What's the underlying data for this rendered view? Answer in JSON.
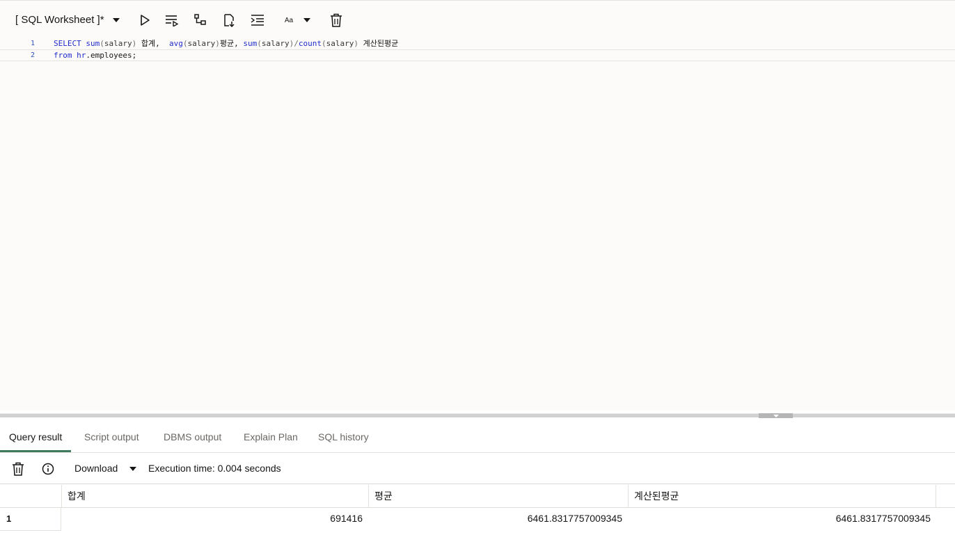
{
  "worksheet": {
    "title": "[ SQL Worksheet ]*",
    "toolbar_icons": [
      "title-dropdown-caret",
      "run-statement-icon",
      "run-script-icon",
      "explain-plan-icon",
      "autotrace-icon",
      "format-code-icon",
      "font-size-icon",
      "clear-editor-icon"
    ],
    "font_size_label": "Aa"
  },
  "editor": {
    "lines": [
      {
        "number": "1",
        "tokens": [
          {
            "text": "SELECT",
            "kind": "kw"
          },
          {
            "text": " ",
            "kind": "plain"
          },
          {
            "text": "sum",
            "kind": "fn"
          },
          {
            "text": "(",
            "kind": "paren"
          },
          {
            "text": "salary",
            "kind": "ident"
          },
          {
            "text": ")",
            "kind": "paren"
          },
          {
            "text": " 합계,  ",
            "kind": "plain"
          },
          {
            "text": "avg",
            "kind": "fn"
          },
          {
            "text": "(",
            "kind": "paren"
          },
          {
            "text": "salary",
            "kind": "ident"
          },
          {
            "text": ")",
            "kind": "paren"
          },
          {
            "text": "평균, ",
            "kind": "plain"
          },
          {
            "text": "sum",
            "kind": "fn"
          },
          {
            "text": "(",
            "kind": "paren"
          },
          {
            "text": "salary",
            "kind": "ident"
          },
          {
            "text": ")/",
            "kind": "paren"
          },
          {
            "text": "count",
            "kind": "fn"
          },
          {
            "text": "(",
            "kind": "paren"
          },
          {
            "text": "salary",
            "kind": "ident"
          },
          {
            "text": ")",
            "kind": "paren"
          },
          {
            "text": " 계산된평균",
            "kind": "plain"
          }
        ]
      },
      {
        "number": "2",
        "tokens": [
          {
            "text": "from",
            "kind": "kw"
          },
          {
            "text": " ",
            "kind": "plain"
          },
          {
            "text": "hr",
            "kind": "kw"
          },
          {
            "text": ".employees;",
            "kind": "plain"
          }
        ]
      }
    ]
  },
  "results": {
    "tabs": [
      {
        "label": "Query result",
        "active": true
      },
      {
        "label": "Script output",
        "active": false
      },
      {
        "label": "DBMS output",
        "active": false
      },
      {
        "label": "Explain Plan",
        "active": false
      },
      {
        "label": "SQL history",
        "active": false
      }
    ],
    "toolbar": {
      "download_label": "Download",
      "execution_time": "Execution time: 0.004 seconds"
    },
    "grid": {
      "columns": [
        "합계",
        "평균",
        "계산된평균"
      ],
      "rows": [
        {
          "row_number": "1",
          "cells": [
            "691416",
            "6461.8317757009345",
            "6461.8317757009345"
          ]
        }
      ]
    }
  },
  "colors": {
    "keyword": "#1f2ccc",
    "active_tab_underline": "#3d7a5e",
    "editor_background": "#fcfbfa"
  }
}
